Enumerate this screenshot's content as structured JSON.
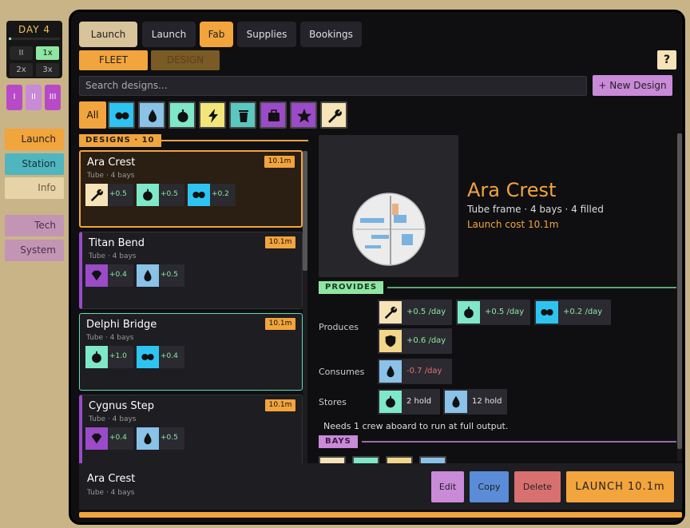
{
  "sidebar": {
    "day_label": "DAY 4",
    "speeds": [
      "II",
      "1x",
      "2x",
      "3x"
    ],
    "tiers": [
      "I",
      "II",
      "III"
    ],
    "nav": [
      "Launch",
      "Station",
      "Info",
      "Tech",
      "System"
    ]
  },
  "tabs": [
    "Launch",
    "Launch",
    "Fab",
    "Supplies",
    "Bookings"
  ],
  "subtabs": [
    "FLEET",
    "DESIGN"
  ],
  "help_label": "?",
  "search": {
    "placeholder": "Search designs..."
  },
  "new_design_label": "+ New Design",
  "filters": {
    "all_label": "All",
    "icons": [
      "orbit-icon",
      "water-icon",
      "food-icon",
      "power-icon",
      "trash-icon",
      "cargo-icon",
      "star-icon",
      "wrench-icon"
    ]
  },
  "designs_header": "DESIGNS · 10",
  "designs": [
    {
      "name": "Ara Crest",
      "sub": "Tube · 4 bays",
      "cost": "10.1m",
      "chips": [
        {
          "icon": "wrench-icon",
          "value": "+0.5"
        },
        {
          "icon": "food-icon",
          "value": "+0.5"
        },
        {
          "icon": "orbit-icon",
          "value": "+0.2"
        }
      ]
    },
    {
      "name": "Titan Bend",
      "sub": "Tube · 4 bays",
      "cost": "10.1m",
      "chips": [
        {
          "icon": "gem-icon",
          "value": "+0.4"
        },
        {
          "icon": "water-icon",
          "value": "+0.5"
        }
      ]
    },
    {
      "name": "Delphi Bridge",
      "sub": "Tube · 4 bays",
      "cost": "10.1m",
      "chips": [
        {
          "icon": "food-icon",
          "value": "+1.0"
        },
        {
          "icon": "orbit-icon",
          "value": "+0.4"
        }
      ]
    },
    {
      "name": "Cygnus Step",
      "sub": "Tube · 4 bays",
      "cost": "10.1m",
      "chips": [
        {
          "icon": "gem-icon",
          "value": "+0.4"
        },
        {
          "icon": "water-icon",
          "value": "+0.5"
        }
      ]
    }
  ],
  "detail": {
    "title": "Ara Crest",
    "sub": "Tube frame · 4 bays · 4 filled",
    "cost": "Launch cost 10.1m",
    "provides_header": "PROVIDES",
    "produces_label": "Produces",
    "produces": [
      {
        "icon": "wrench-icon",
        "value": "+0.5 /day"
      },
      {
        "icon": "food-icon",
        "value": "+0.5 /day"
      },
      {
        "icon": "orbit-icon",
        "value": "+0.2 /day"
      },
      {
        "icon": "shield-icon",
        "value": "+0.6 /day"
      }
    ],
    "consumes_label": "Consumes",
    "consumes": [
      {
        "icon": "water-icon",
        "value": "-0.7 /day"
      }
    ],
    "stores_label": "Stores",
    "stores": [
      {
        "icon": "food-icon",
        "value": "2 hold"
      },
      {
        "icon": "water-icon",
        "value": "12 hold"
      }
    ],
    "note": "Needs 1 crew aboard to run at full output.",
    "bays_header": "BAYS"
  },
  "footer": {
    "name": "Ara Crest",
    "sub": "Tube · 4 bays",
    "edit_label": "Edit",
    "copy_label": "Copy",
    "delete_label": "Delete",
    "launch_label": "LAUNCH  10.1m"
  },
  "colors": {
    "accent": "#f2a43d",
    "positive": "#8ee6a2",
    "negative": "#e8707a",
    "wrench": "#f6e3b8",
    "food": "#7ee8c8",
    "orbit": "#2ec4f2",
    "gem": "#9b4ac8",
    "water": "#8ac2e8",
    "shield": "#f2d78a"
  }
}
